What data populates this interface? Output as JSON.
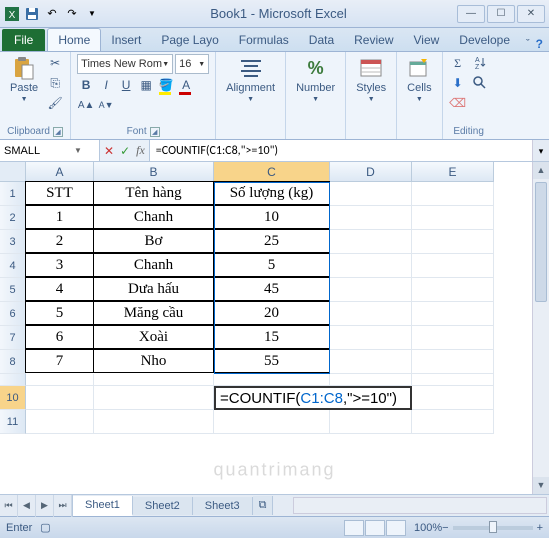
{
  "title": "Book1 - Microsoft Excel",
  "tabs": [
    "File",
    "Home",
    "Insert",
    "Page Layo",
    "Formulas",
    "Data",
    "Review",
    "View",
    "Develope"
  ],
  "active_tab": "Home",
  "ribbon": {
    "clipboard": {
      "label": "Clipboard",
      "paste": "Paste"
    },
    "font": {
      "label": "Font",
      "name": "Times New Rom",
      "size": "16"
    },
    "alignment": {
      "label": "Alignment"
    },
    "number": {
      "label": "Number"
    },
    "styles": {
      "label": "Styles"
    },
    "cells": {
      "label": "Cells"
    },
    "editing": {
      "label": "Editing"
    }
  },
  "namebox": "SMALL",
  "formula_bar": "=COUNTIF(C1:C8,\">=10\")",
  "columns": [
    "A",
    "B",
    "C",
    "D",
    "E"
  ],
  "rows": [
    "1",
    "2",
    "3",
    "4",
    "5",
    "6",
    "7",
    "8",
    "",
    "10",
    "11"
  ],
  "headers": {
    "a": "STT",
    "b": "Tên hàng",
    "c": "Số lượng (kg)"
  },
  "data": [
    {
      "stt": "1",
      "name": "Chanh",
      "qty": "10"
    },
    {
      "stt": "2",
      "name": "Bơ",
      "qty": "25"
    },
    {
      "stt": "3",
      "name": "Chanh",
      "qty": "5"
    },
    {
      "stt": "4",
      "name": "Dưa hấu",
      "qty": "45"
    },
    {
      "stt": "5",
      "name": "Măng cầu",
      "qty": "20"
    },
    {
      "stt": "6",
      "name": "Xoài",
      "qty": "15"
    },
    {
      "stt": "7",
      "name": "Nho",
      "qty": "55"
    }
  ],
  "cell_formula": {
    "prefix": "=COUNTIF(",
    "ref": "C1:C8",
    "suffix": ",\">=10\")"
  },
  "sheets": [
    "Sheet1",
    "Sheet2",
    "Sheet3"
  ],
  "status": {
    "mode": "Enter",
    "zoom": "100%",
    "zoom_minus": "−",
    "zoom_plus": "+"
  },
  "watermark": "quantrimang"
}
